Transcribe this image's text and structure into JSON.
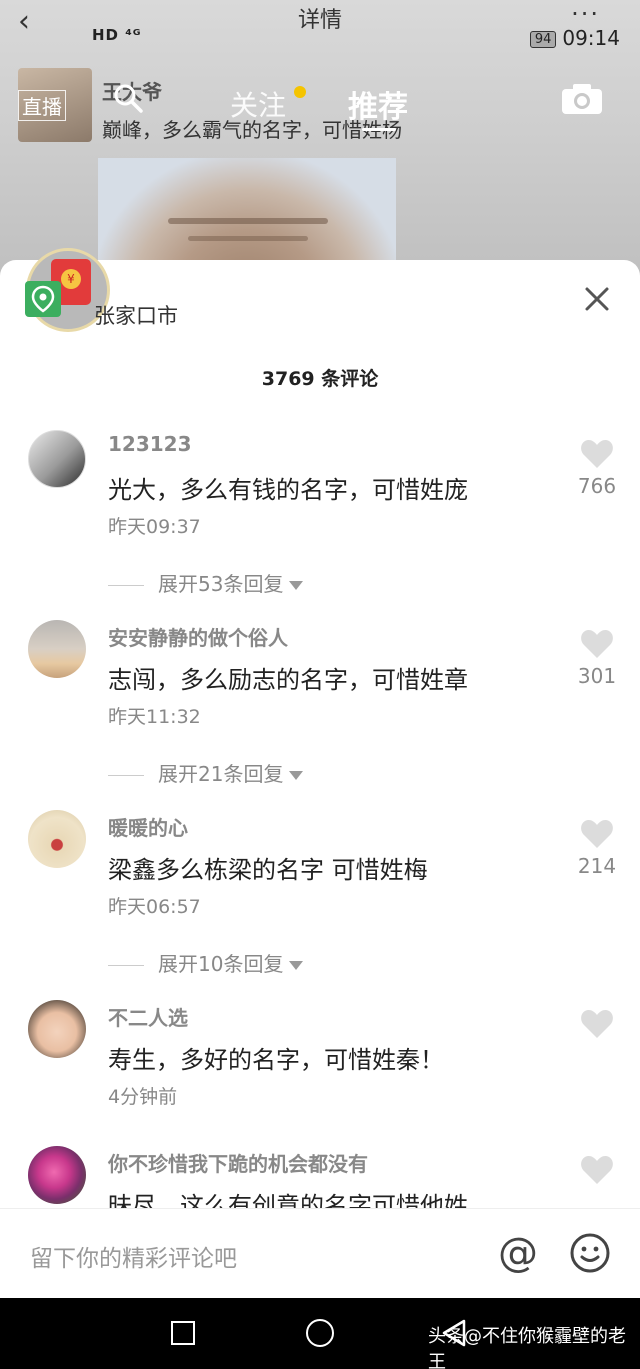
{
  "status_bar": {
    "left_text": "HD ⁴ᴳ",
    "title": "详情",
    "battery": "94",
    "time": "09:14"
  },
  "post": {
    "author_name": "王大爷",
    "caption": "巅峰，多么霸气的名字，可惜姓杨"
  },
  "top_nav": {
    "live_label": "直播",
    "follow_label": "关注",
    "recommend_label": "推荐"
  },
  "sheet": {
    "location": "张家口市",
    "comment_count": "3769 条评论",
    "redpacket_symbol": "¥"
  },
  "comments": [
    {
      "user": "123123",
      "text": "光大，多么有钱的名字，可惜姓庞",
      "time": "昨天09:37",
      "likes": "766",
      "expand": "展开53条回复"
    },
    {
      "user": "安安静静的做个俗人",
      "text": "志闯，多么励志的名字，可惜姓章",
      "time": "昨天11:32",
      "likes": "301",
      "expand": "展开21条回复"
    },
    {
      "user": "暖暖的心",
      "text": "梁鑫多么栋梁的名字 可惜姓梅",
      "time": "昨天06:57",
      "likes": "214",
      "expand": "展开10条回复"
    },
    {
      "user": "不二人选",
      "text": "寿生，多好的名字，可惜姓秦！",
      "time": "4分钟前",
      "likes": "",
      "expand": ""
    },
    {
      "user": "你不珍惜我下跪的机会都没有",
      "text": "昧尽，这么有创意的名字可惜他姓",
      "time": "",
      "likes": "",
      "expand": ""
    }
  ],
  "input_bar": {
    "placeholder": "留下你的精彩评论吧",
    "at_symbol": "@"
  },
  "watermark": "头条@不住你猴霾壁的老王",
  "colors": {
    "accent_dot": "#f5c400",
    "redpacket": "#e23b3b",
    "location_pin": "#3cae5f"
  }
}
